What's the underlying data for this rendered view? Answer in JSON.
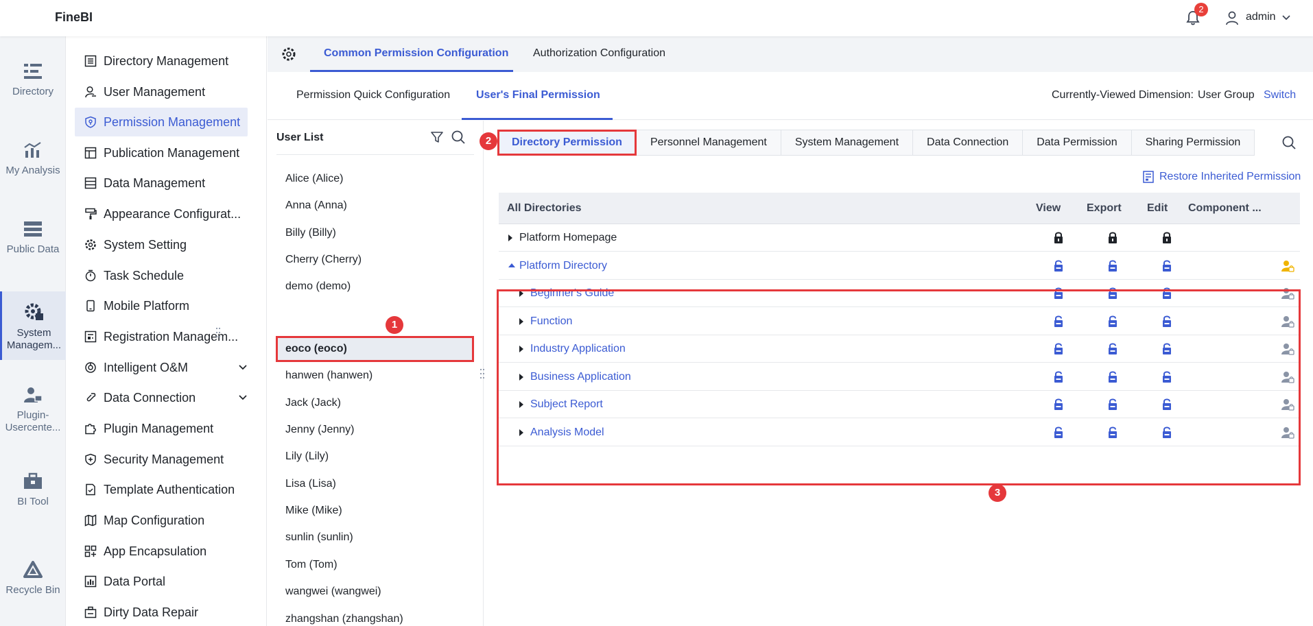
{
  "app": {
    "logo": "FineBI"
  },
  "topbar": {
    "notifications": "2",
    "username": "admin"
  },
  "rail": [
    {
      "label": "Directory",
      "icon": "directory-icon"
    },
    {
      "label": "My Analysis",
      "icon": "analysis-icon"
    },
    {
      "label": "Public Data",
      "icon": "public-data-icon"
    },
    {
      "label": "System Managem...",
      "icon": "system-management-icon",
      "active": true
    },
    {
      "label": "Plugin-Usercente...",
      "icon": "plugin-icon"
    },
    {
      "label": "BI Tool",
      "icon": "toolbox-icon"
    },
    {
      "label": "Recycle Bin",
      "icon": "recycle-bin-icon"
    }
  ],
  "nav": [
    {
      "label": "Directory Management",
      "icon": "list-icon"
    },
    {
      "label": "User Management",
      "icon": "user-icon"
    },
    {
      "label": "Permission Management",
      "icon": "shield-icon",
      "active": true
    },
    {
      "label": "Publication Management",
      "icon": "publication-icon"
    },
    {
      "label": "Data Management",
      "icon": "data-icon"
    },
    {
      "label": "Appearance Configurat...",
      "icon": "brush-icon"
    },
    {
      "label": "System Setting",
      "icon": "gear-icon"
    },
    {
      "label": "Task Schedule",
      "icon": "timer-icon"
    },
    {
      "label": "Mobile Platform",
      "icon": "mobile-icon"
    },
    {
      "label": "Registration Managem...",
      "icon": "registration-icon"
    },
    {
      "label": "Intelligent O&M",
      "icon": "om-icon",
      "expand": true
    },
    {
      "label": "Data Connection",
      "icon": "link-icon",
      "expand": true
    },
    {
      "label": "Plugin Management",
      "icon": "puzzle-icon"
    },
    {
      "label": "Security Management",
      "icon": "security-icon"
    },
    {
      "label": "Template Authentication",
      "icon": "template-icon"
    },
    {
      "label": "Map Configuration",
      "icon": "map-icon"
    },
    {
      "label": "App Encapsulation",
      "icon": "app-icon"
    },
    {
      "label": "Data Portal",
      "icon": "portal-icon"
    },
    {
      "label": "Dirty Data Repair",
      "icon": "repair-icon"
    }
  ],
  "tabs": [
    {
      "label": "Common Permission Configuration",
      "active": true
    },
    {
      "label": "Authorization Configuration"
    }
  ],
  "subtabs": [
    {
      "label": "Permission Quick Configuration"
    },
    {
      "label": "User's Final Permission",
      "active": true
    }
  ],
  "dimension": {
    "label": "Currently-Viewed Dimension:",
    "value": "User Group",
    "switch": "Switch"
  },
  "userlist": {
    "title": "User List",
    "users": [
      "Alice (Alice)",
      "Anna (Anna)",
      "Billy (Billy)",
      "Cherry (Cherry)",
      "demo (demo)",
      "eoco (eoco)",
      "hanwen (hanwen)",
      "Jack (Jack)",
      "Jenny (Jenny)",
      "Lily (Lily)",
      "Lisa (Lisa)",
      "Mike (Mike)",
      "sunlin (sunlin)",
      "Tom (Tom)",
      "wangwei (wangwei)",
      "zhangshan (zhangshan)"
    ],
    "selected": "eoco (eoco)"
  },
  "markers": [
    "1",
    "2",
    "3"
  ],
  "permission_tabs": [
    {
      "label": "Directory Permission",
      "active": true
    },
    {
      "label": "Personnel Management"
    },
    {
      "label": "System Management"
    },
    {
      "label": "Data Connection"
    },
    {
      "label": "Data Permission"
    },
    {
      "label": "Sharing Permission"
    }
  ],
  "restore_label": "Restore Inherited Permission",
  "table": {
    "headers": [
      "All Directories",
      "View",
      "Export",
      "Edit",
      "Component ..."
    ],
    "rows": [
      {
        "name": "Platform Homepage",
        "level": 0,
        "expanded": false,
        "link": false,
        "lock": "locked"
      },
      {
        "name": "Platform Directory",
        "level": 0,
        "expanded": true,
        "link": true,
        "lock": "unlocked",
        "person": "active"
      },
      {
        "name": "Beginner's Guide",
        "level": 1,
        "expanded": false,
        "link": true,
        "lock": "unlocked",
        "person": "inactive"
      },
      {
        "name": "Function",
        "level": 1,
        "expanded": false,
        "link": true,
        "lock": "unlocked",
        "person": "inactive"
      },
      {
        "name": "Industry Application",
        "level": 1,
        "expanded": false,
        "link": true,
        "lock": "unlocked",
        "person": "inactive"
      },
      {
        "name": "Business Application",
        "level": 1,
        "expanded": false,
        "link": true,
        "lock": "unlocked",
        "person": "inactive"
      },
      {
        "name": "Subject Report",
        "level": 1,
        "expanded": false,
        "link": true,
        "lock": "unlocked",
        "person": "inactive"
      },
      {
        "name": "Analysis Model",
        "level": 1,
        "expanded": false,
        "link": true,
        "lock": "unlocked",
        "person": "inactive"
      }
    ]
  },
  "colors": {
    "accent": "#3b5bd3",
    "highlight": "#e5383b",
    "person_active": "#f0b400"
  }
}
